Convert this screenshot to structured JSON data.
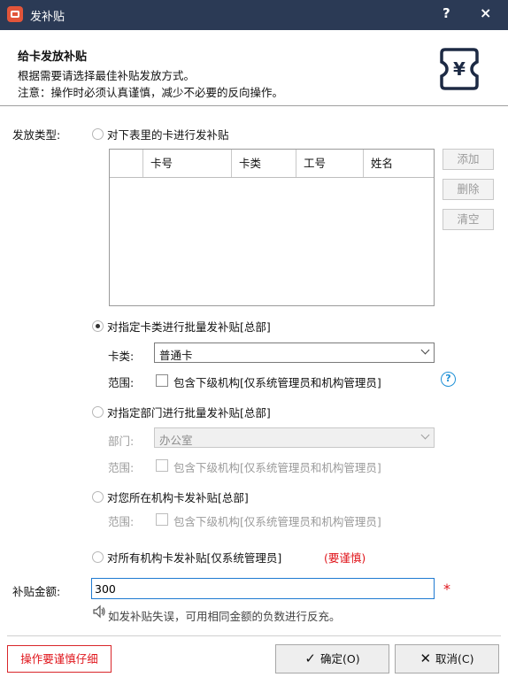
{
  "window": {
    "title": "发补贴",
    "help": "?",
    "close": "×"
  },
  "header": {
    "title": "给卡发放补贴",
    "desc1": "根据需要请选择最佳补贴发放方式。",
    "desc2": "注意：操作时必须认真谨慎，减少不必要的反向操作。",
    "logo_symbol": "¥"
  },
  "issue_type": {
    "label": "发放类型:",
    "options": [
      {
        "label": "对下表里的卡进行发补贴",
        "selected": false
      },
      {
        "label": "对指定卡类进行批量发补贴[总部]",
        "selected": true
      },
      {
        "label": "对指定部门进行批量发补贴[总部]",
        "selected": false
      },
      {
        "label": "对您所在机构卡发补贴[总部]",
        "selected": false
      },
      {
        "label": "对所有机构卡发补贴[仅系统管理员]",
        "caution": "(要谨慎)",
        "selected": false
      }
    ]
  },
  "card_table": {
    "columns": [
      "",
      "卡号",
      "卡类",
      "工号",
      "姓名"
    ],
    "rows": []
  },
  "side_buttons": {
    "add": "添加",
    "delete": "删除",
    "clear": "清空"
  },
  "card_type": {
    "label": "卡类:",
    "value": "普通卡",
    "scope_label": "范围:",
    "scope_text": "包含下级机构[仅系统管理员和机构管理员]",
    "scope_checked": false
  },
  "department": {
    "label": "部门:",
    "value": "办公室",
    "scope_label": "范围:",
    "scope_text": "包含下级机构[仅系统管理员和机构管理员]",
    "scope_checked": false
  },
  "institution": {
    "scope_label": "范围:",
    "scope_text": "包含下级机构[仅系统管理员和机构管理员]",
    "scope_checked": false
  },
  "amount": {
    "label": "补贴金额:",
    "value": "300",
    "required_mark": "*"
  },
  "hint": "如发补贴失误，可用相同金额的负数进行反充。",
  "footer": {
    "warning": "操作要谨慎仔细",
    "ok": "确定(O)",
    "cancel": "取消(C)"
  },
  "colors": {
    "titlebar": "#2b3a55",
    "accent": "#1f7ad1",
    "caution": "#e0161c"
  }
}
